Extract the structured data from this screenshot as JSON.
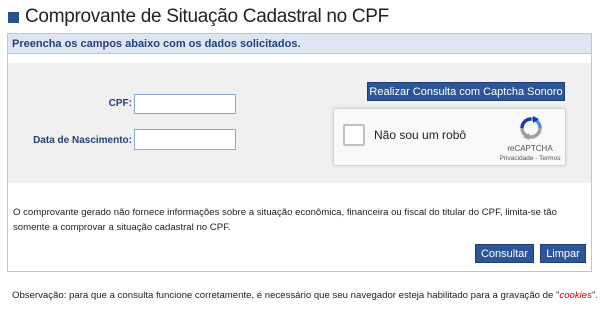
{
  "page": {
    "title": "Comprovante de Situação Cadastral no CPF"
  },
  "panel": {
    "header": "Preencha os campos abaixo com os dados solicitados.",
    "cpf_label": "CPF:",
    "cpf_value": "",
    "birth_label": "Data de Nascimento:",
    "birth_value": "",
    "audio_button": "Realizar Consulta com Captcha Sonoro",
    "captcha": {
      "checkbox_label": "Não sou um robô",
      "brand": "reCAPTCHA",
      "privacy": "Privacidade",
      "separator": " - ",
      "terms": "Termos"
    },
    "info_text": "O comprovante gerado não fornece informações sobre a situação econômica, financeira ou fiscal do titular do CPF, limita-se tão somente a comprovar a situação cadastral no CPF.",
    "consult_button": "Consultar",
    "clear_button": "Limpar"
  },
  "note": {
    "prefix": "Observação: para que a consulta funcione corretamente, é necessário que seu navegador esteja habilitado para a gravação de \"",
    "highlight": "cookies",
    "suffix": "\"."
  },
  "colors": {
    "accent": "#2c5698",
    "header_bg": "#dde6f3",
    "label": "#243f7a",
    "highlight": "#cc0000"
  },
  "icons": {
    "title_marker": "square-bullet-icon",
    "captcha_logo": "recaptcha-icon"
  }
}
